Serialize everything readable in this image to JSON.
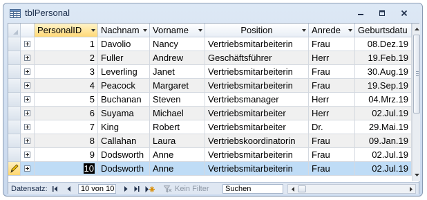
{
  "window": {
    "title": "tblPersonal",
    "icon": "table-icon",
    "controls": [
      "minimize-icon",
      "restore-icon",
      "close-icon"
    ]
  },
  "columns": [
    {
      "label": "PersonalID",
      "has_dropdown": true
    },
    {
      "label": "Nachnam",
      "has_dropdown": true
    },
    {
      "label": "Vorname",
      "has_dropdown": true
    },
    {
      "label": "Position",
      "has_dropdown": true
    },
    {
      "label": "Anrede",
      "has_dropdown": true
    },
    {
      "label": "Geburtsdatu",
      "has_dropdown": false
    }
  ],
  "rows": [
    {
      "id": "1",
      "nachname": "Davolio",
      "vorname": "Nancy",
      "position": "Vertriebsmitarbeiterin",
      "anrede": "Frau",
      "geburtsdatum": "08.Dez.19"
    },
    {
      "id": "2",
      "nachname": "Fuller",
      "vorname": "Andrew",
      "position": "Geschäftsführer",
      "anrede": "Herr",
      "geburtsdatum": "19.Feb.19"
    },
    {
      "id": "3",
      "nachname": "Leverling",
      "vorname": "Janet",
      "position": "Vertriebsmitarbeiterin",
      "anrede": "Frau",
      "geburtsdatum": "30.Aug.19"
    },
    {
      "id": "4",
      "nachname": "Peacock",
      "vorname": "Margaret",
      "position": "Vertriebsmitarbeiterin",
      "anrede": "Frau",
      "geburtsdatum": "19.Sep.19"
    },
    {
      "id": "5",
      "nachname": "Buchanan",
      "vorname": "Steven",
      "position": "Vertriebsmanager",
      "anrede": "Herr",
      "geburtsdatum": "04.Mrz.19"
    },
    {
      "id": "6",
      "nachname": "Suyama",
      "vorname": "Michael",
      "position": "Vertriebsmitarbeiter",
      "anrede": "Herr",
      "geburtsdatum": "02.Jul.19"
    },
    {
      "id": "7",
      "nachname": "King",
      "vorname": "Robert",
      "position": "Vertriebsmitarbeiter",
      "anrede": "Dr.",
      "geburtsdatum": "29.Mai.19"
    },
    {
      "id": "8",
      "nachname": "Callahan",
      "vorname": "Laura",
      "position": "Vertriebskoordinatorin",
      "anrede": "Frau",
      "geburtsdatum": "09.Jan.19"
    },
    {
      "id": "9",
      "nachname": "Dodsworth",
      "vorname": "Anne",
      "position": "Vertriebsmitarbeiterin",
      "anrede": "Frau",
      "geburtsdatum": "02.Jul.19"
    },
    {
      "id": "10",
      "nachname": "Dodsworth",
      "vorname": "Anne",
      "position": "Vertriebsmitarbeiterin",
      "anrede": "Frau",
      "geburtsdatum": "02.Jul.19"
    }
  ],
  "selected_row_index": 9,
  "navigation": {
    "label": "Datensatz:",
    "record_position": "10 von 10",
    "filter_label": "Kein Filter",
    "search_value": "Suchen"
  },
  "colors": {
    "selected_row": "#bfdcf6",
    "active_header": "#ffd978",
    "window_frame": "#c9d9ee"
  }
}
